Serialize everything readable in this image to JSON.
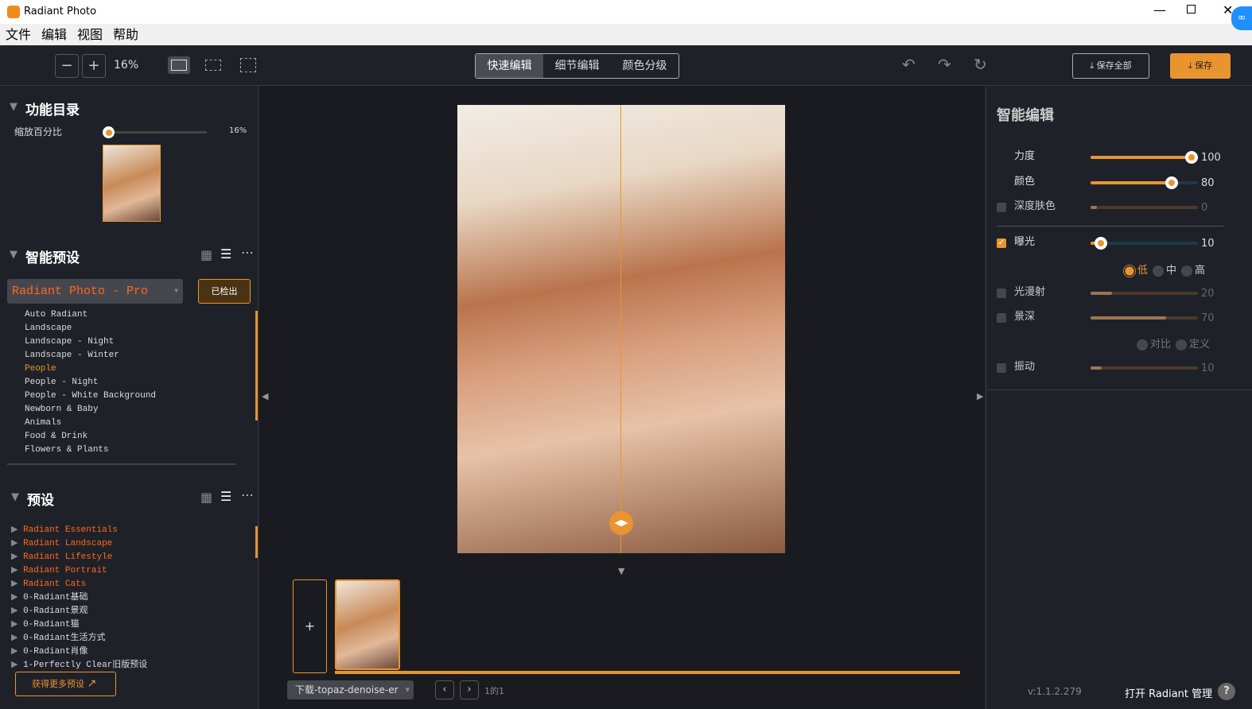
{
  "window": {
    "title": "Radiant Photo"
  },
  "menu": [
    "文件",
    "编辑",
    "视图",
    "帮助"
  ],
  "toolbar": {
    "zoom_out": "−",
    "zoom_in": "+",
    "zoom": "16%",
    "tabs": [
      "快速编辑",
      "细节编辑",
      "颜色分级"
    ],
    "active_tab": 0,
    "save_all": "保存全部",
    "save": "保存"
  },
  "colors": {
    "accent": "#e8952f",
    "preset_highlight": "#ff6a1a",
    "bg": "#1f2129"
  },
  "left": {
    "nav_title": "功能目录",
    "zoom_label": "缩放百分比",
    "zoom_value": "16%",
    "zoom_percent": 16,
    "smart_title": "智能预设",
    "smart_select": "Radiant Photo - Pro",
    "detected": "已检出",
    "smart_items": [
      "Auto Radiant",
      "Landscape",
      "Landscape - Night",
      "Landscape - Winter",
      "People",
      "People - Night",
      "People - White Background",
      "Newborn & Baby",
      "Animals",
      "Food & Drink",
      "Flowers & Plants"
    ],
    "smart_selected": 4,
    "preset_title": "预设",
    "presets": [
      "Radiant Essentials",
      "Radiant Landscape",
      "Radiant Lifestyle",
      "Radiant Portrait",
      "Radiant Cats",
      "0-Radiant基础",
      "0-Radiant景观",
      "0-Radiant猫",
      "0-Radiant生活方式",
      "0-Radiant肖像",
      "1-Perfectly Clear旧版预设"
    ],
    "more_presets": "获得更多预设"
  },
  "center": {
    "add": "+",
    "folder": "下载-topaz-denoise-er",
    "page": "1的1"
  },
  "right": {
    "title": "智能编辑",
    "sliders": [
      {
        "label": "力度",
        "value": 100,
        "checkbox": null,
        "enabled": true
      },
      {
        "label": "颜色",
        "value": 80,
        "checkbox": null,
        "enabled": true
      },
      {
        "label": "深度肤色",
        "value": 0,
        "checkbox": false,
        "enabled": false
      },
      {
        "label": "曝光",
        "value": 10,
        "checkbox": true,
        "enabled": true
      },
      {
        "label": "光漫射",
        "value": 20,
        "checkbox": false,
        "enabled": false
      },
      {
        "label": "景深",
        "value": 70,
        "checkbox": false,
        "enabled": false
      },
      {
        "label": "振动",
        "value": 10,
        "checkbox": false,
        "enabled": false
      }
    ],
    "exposure_levels": [
      "低",
      "中",
      "高"
    ],
    "exposure_selected": 0,
    "depth_modes": [
      "对比",
      "定义"
    ],
    "depth_selected": 0,
    "version": "v:1.1.2.279",
    "open_manager": "打开 Radiant 管理",
    "help": "?"
  }
}
